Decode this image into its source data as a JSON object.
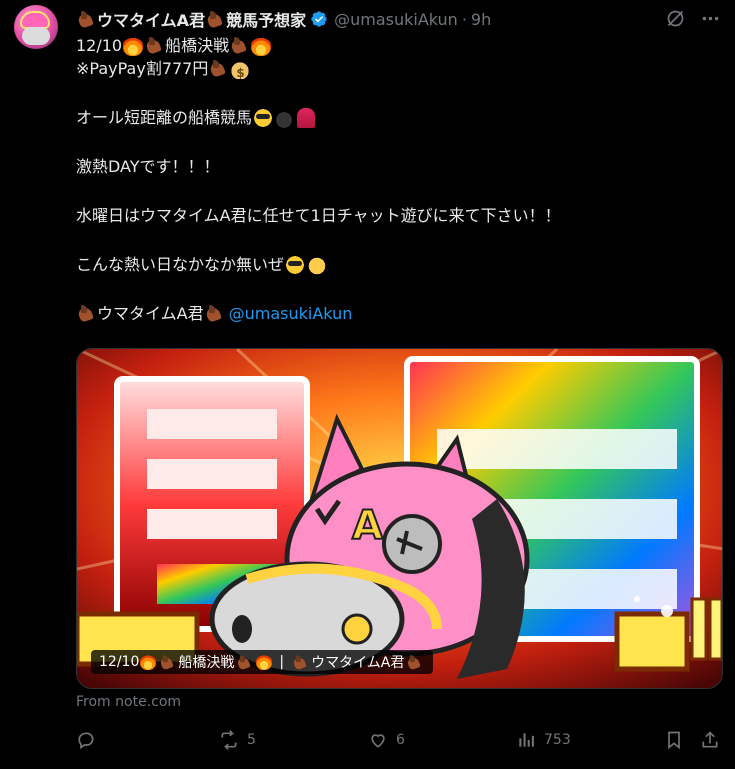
{
  "author": {
    "display_name_left": "ウマタイムA君",
    "display_name_right": "競馬予想家",
    "handle": "@umasukiAkun",
    "time": "9h",
    "separator": "·"
  },
  "body": {
    "line1_a": "12/10",
    "line1_b": "船橋決戦",
    "line2": "※PayPay割777円",
    "line3": "オール短距離の船橋競馬",
    "line4": "激熱DAYです！！！",
    "line5": "水曜日はウマタイムA君に任せて1日チャット遊びに来て下さい！！",
    "line6": "こんな熱い日なかなか無いぜ",
    "line7_name": "ウマタイムA君",
    "line7_mention": "@umasukiAkun"
  },
  "card": {
    "label_a": "12/10",
    "label_b": "船橋決戦",
    "label_sep": "|",
    "label_c": "ウマタイムA君",
    "source": "From note.com"
  },
  "actions": {
    "replies": "",
    "reposts": "5",
    "likes": "6",
    "views": "753"
  },
  "colors": {
    "accent": "#1d9bf0",
    "text": "#e7e9ea",
    "muted": "#71767b",
    "background": "#000000"
  },
  "icons": [
    "grok-icon",
    "more-icon",
    "verified-icon",
    "reply-icon",
    "repost-icon",
    "like-icon",
    "views-icon",
    "bookmark-icon",
    "share-icon"
  ]
}
